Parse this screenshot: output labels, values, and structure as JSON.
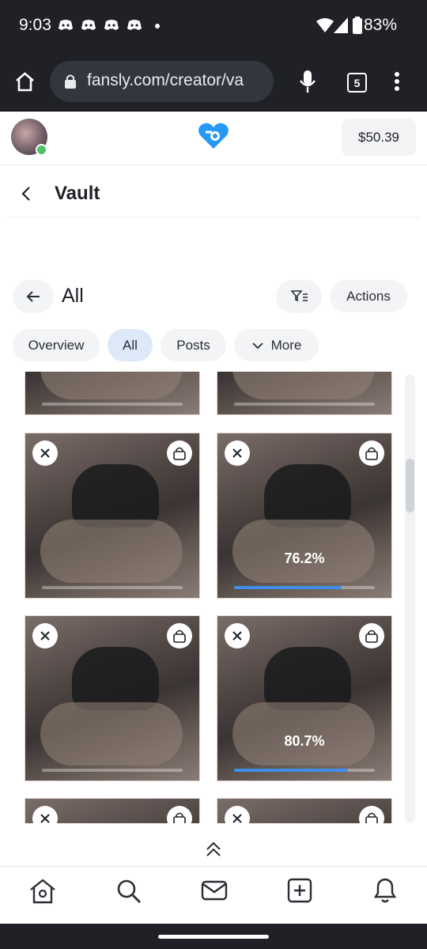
{
  "status": {
    "time": "9:03",
    "battery": "83%",
    "notifications": [
      "discord-icon",
      "discord-icon",
      "discord-icon",
      "discord-icon"
    ]
  },
  "browser": {
    "url": "fansly.com/creator/va",
    "tab_count": "5"
  },
  "header": {
    "balance": "$50.39"
  },
  "vault": {
    "title": "Vault"
  },
  "collection": {
    "title": "All",
    "actions_label": "Actions"
  },
  "tabs": [
    {
      "label": "Overview"
    },
    {
      "label": "All"
    },
    {
      "label": "Posts"
    },
    {
      "label": "More"
    }
  ],
  "tiles": [
    {
      "progress": null,
      "label": ""
    },
    {
      "progress": null,
      "label": ""
    },
    {
      "progress": null,
      "label": ""
    },
    {
      "progress": 0.762,
      "label": "76.2%"
    },
    {
      "progress": null,
      "label": ""
    },
    {
      "progress": 0.807,
      "label": "80.7%"
    },
    {
      "progress": null,
      "label": ""
    },
    {
      "progress": null,
      "label": ""
    }
  ],
  "colors": {
    "accent": "#3f8ef0",
    "brand": "#2699f7",
    "online": "#4cc26a",
    "active_tab": "#dde9f8"
  }
}
